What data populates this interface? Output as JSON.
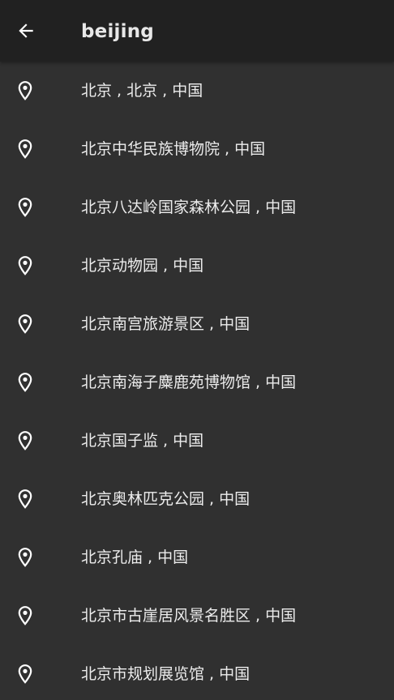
{
  "search": {
    "query": "beijing"
  },
  "icons": {
    "back": "arrow-left-icon",
    "location": "map-pin-icon"
  },
  "colors": {
    "background": "#303030",
    "toolbar": "#212121",
    "text": "#ececec"
  },
  "results": [
    {
      "label": "北京 , 北京 , 中国"
    },
    {
      "label": "北京中华民族博物院 , 中国"
    },
    {
      "label": "北京八达岭国家森林公园 , 中国"
    },
    {
      "label": "北京动物园 , 中国"
    },
    {
      "label": "北京南宫旅游景区 , 中国"
    },
    {
      "label": "北京南海子麋鹿苑博物馆 , 中国"
    },
    {
      "label": "北京国子监 , 中国"
    },
    {
      "label": "北京奥林匹克公园 , 中国"
    },
    {
      "label": "北京孔庙 , 中国"
    },
    {
      "label": "北京市古崖居风景名胜区 , 中国"
    },
    {
      "label": "北京市规划展览馆 , 中国"
    }
  ]
}
